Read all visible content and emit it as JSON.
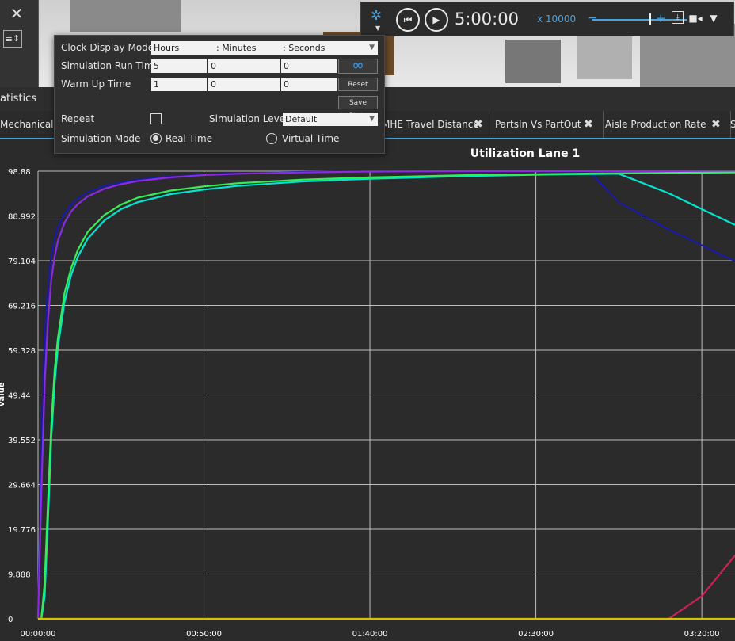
{
  "left_panel": {
    "close_icon": "close-icon",
    "sort_icon": "sort-icon"
  },
  "toolbar": {
    "gear_icon": "gear-icon",
    "rewind_icon": "rewind-icon",
    "play_icon": "play-icon",
    "time": "5:00:00",
    "speed": "x 10000",
    "slider_minus": "−",
    "slider_plus": "+",
    "icons": [
      "pdf-icon",
      "video-camera-icon",
      "filter-icon"
    ]
  },
  "popup": {
    "clock_label": "Clock Display Mode",
    "clock_hours": "Hours",
    "clock_minutes": ": Minutes",
    "clock_seconds": ": Seconds",
    "run_label": "Simulation Run Time",
    "run_h": "5",
    "run_m": "0",
    "run_s": "0",
    "infinity": "∞",
    "warm_label": "Warm Up Time",
    "warm_h": "1",
    "warm_m": "0",
    "warm_s": "0",
    "reset": "Reset",
    "save_state": "Save State",
    "repeat_label": "Repeat",
    "level_label": "Simulation Level",
    "level_value": "Default",
    "mode_label": "Simulation Mode",
    "real_time": "Real Time",
    "virtual_time": "Virtual Time"
  },
  "stats": {
    "title": "atistics"
  },
  "tabs": [
    {
      "label": "Mechanical Sa"
    },
    {
      "label": "MHE Travel Distance"
    },
    {
      "label": "PartsIn Vs PartOut"
    },
    {
      "label": "Aisle Production Rate"
    },
    {
      "label": "S"
    }
  ],
  "chart_data": {
    "type": "line",
    "title": "Utilization Lane 1",
    "ylabel": "Value",
    "xlabel": "",
    "y_ticks": [
      "98.88",
      "88.992",
      "79.104",
      "69.216",
      "59.328",
      "49.44",
      "39.552",
      "29.664",
      "19.776",
      "9.888",
      "0"
    ],
    "x_ticks": [
      "00:00:00",
      "00:50:00",
      "01:40:00",
      "02:30:00",
      "03:20:00"
    ],
    "ylim": [
      0,
      98.88
    ],
    "xlim_minutes": [
      0,
      210
    ],
    "grid": true,
    "colors": {
      "background": "#2b2b2b",
      "grid": "#bdbdbd",
      "text": "#ffffff"
    },
    "series": [
      {
        "color": "#1a1aa8",
        "x": [
          0,
          1,
          2,
          3,
          4,
          5,
          6,
          8,
          10,
          12,
          15,
          20,
          25,
          30,
          40,
          50,
          60,
          80,
          100,
          130,
          160,
          166,
          175,
          190,
          210
        ],
        "y": [
          0,
          40,
          62,
          74,
          80,
          84,
          86.5,
          89.5,
          91.5,
          92.8,
          94.2,
          95.6,
          96.4,
          97,
          97.7,
          98.1,
          98.4,
          98.7,
          98.85,
          98.88,
          98.88,
          98.88,
          92,
          86,
          79
        ]
      },
      {
        "color": "#8a2be2",
        "x": [
          0,
          1,
          2,
          3,
          4,
          5,
          6,
          8,
          10,
          12,
          15,
          20,
          25,
          30,
          40,
          50,
          60,
          80,
          100,
          130,
          160,
          190,
          210
        ],
        "y": [
          0,
          28,
          52,
          66,
          75,
          80,
          83.5,
          87.5,
          90,
          91.6,
          93.3,
          95,
          96,
          96.7,
          97.5,
          98,
          98.3,
          98.6,
          98.8,
          98.88,
          98.88,
          98.88,
          98.88
        ]
      },
      {
        "color": "#00e5d0",
        "x": [
          0,
          1,
          2,
          3,
          4,
          5,
          6,
          8,
          10,
          12,
          15,
          20,
          25,
          30,
          40,
          50,
          60,
          80,
          100,
          130,
          160,
          175,
          190,
          210
        ],
        "y": [
          0,
          0,
          5,
          22,
          40,
          52,
          60,
          70,
          76,
          80,
          84,
          88,
          90.5,
          92,
          93.8,
          94.8,
          95.6,
          96.6,
          97.2,
          97.8,
          98.2,
          98.3,
          94,
          87
        ]
      },
      {
        "color": "#33ee55",
        "x": [
          0,
          1,
          2,
          3,
          4,
          5,
          6,
          8,
          10,
          12,
          15,
          20,
          25,
          30,
          40,
          50,
          60,
          80,
          100,
          130,
          160,
          190,
          210
        ],
        "y": [
          0,
          0,
          8,
          26,
          43,
          55,
          62,
          72,
          77.5,
          81.5,
          85.5,
          89.2,
          91.5,
          93,
          94.6,
          95.5,
          96.2,
          97,
          97.5,
          98,
          98.3,
          98.5,
          98.6
        ]
      },
      {
        "color": "#cc2255",
        "x": [
          0,
          150,
          175,
          190,
          200,
          210
        ],
        "y": [
          0,
          0,
          0,
          0,
          5,
          14
        ]
      },
      {
        "color": "#d4c400",
        "x": [
          0,
          210
        ],
        "y": [
          0,
          0
        ]
      }
    ]
  }
}
